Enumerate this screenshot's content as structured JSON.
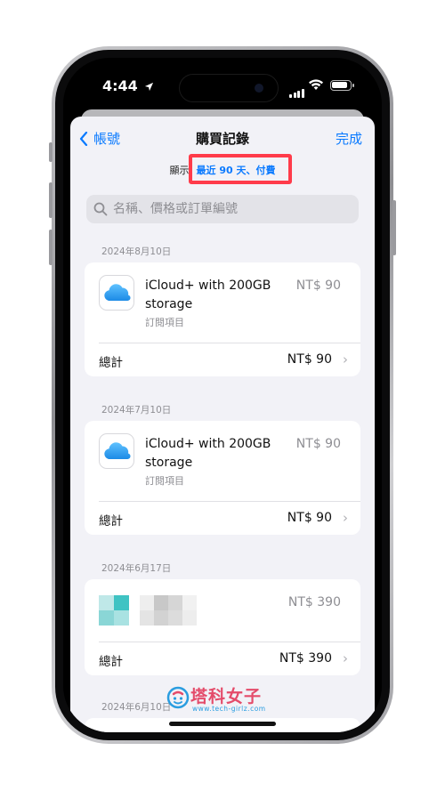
{
  "status_bar": {
    "time": "4:44"
  },
  "nav": {
    "back_label": "帳號",
    "title": "購買記錄",
    "done_label": "完成"
  },
  "filter": {
    "label": "顯示",
    "value": "最近 90 天、付費"
  },
  "search": {
    "placeholder": "名稱、價格或訂單編號"
  },
  "groups": [
    {
      "date": "2024年8月10日",
      "item_name": "iCloud+ with 200GB storage",
      "item_type": "訂閱項目",
      "item_price": "NT$ 90",
      "total_label": "總計",
      "total_value": "NT$ 90"
    },
    {
      "date": "2024年7月10日",
      "item_name": "iCloud+ with 200GB storage",
      "item_type": "訂閱項目",
      "item_price": "NT$ 90",
      "total_label": "總計",
      "total_value": "NT$ 90"
    },
    {
      "date": "2024年6月17日",
      "item_price": "NT$ 390",
      "total_label": "總計",
      "total_value": "NT$ 390"
    },
    {
      "date": "2024年6月10日"
    }
  ],
  "watermark": {
    "text": "塔科女子",
    "url": "www.tech-girlz.com"
  },
  "colors": {
    "accent": "#0a7aff",
    "highlight": "#ff3b4a",
    "background": "#f2f2f7"
  }
}
